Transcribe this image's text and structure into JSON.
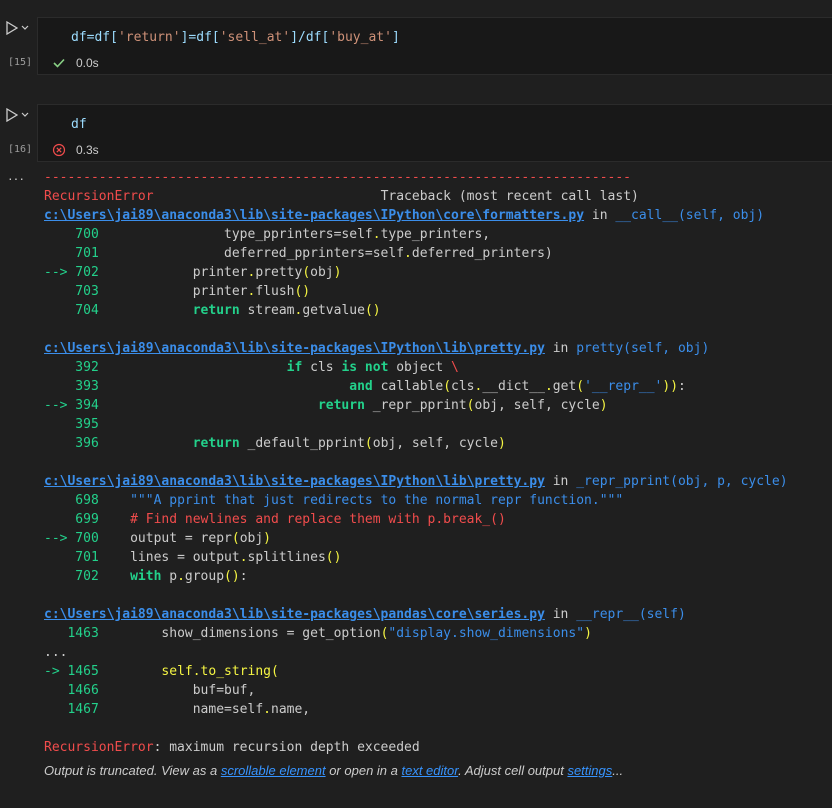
{
  "cells": [
    {
      "exec_count": "[15]",
      "code": [
        "df=df[",
        "'return'",
        "]=df[",
        "'sell_at'",
        "]/df[",
        "'buy_at'",
        "]"
      ],
      "status": "success",
      "time": "0.0s"
    },
    {
      "exec_count": "[16]",
      "code_text": "df",
      "status": "error",
      "time": "0.3s"
    }
  ],
  "output": {
    "more_icon": "ellipsis-icon",
    "dashes": "---------------------------------------------------------------------------",
    "error_name": "RecursionError",
    "traceback_header": "Traceback (most recent call last)",
    "frames": [
      {
        "path": "c:\\Users\\jai89\\anaconda3\\lib\\site-packages\\IPython\\core\\formatters.py",
        "in": " in ",
        "func": "__call__(self, obj)"
      },
      {
        "path": "c:\\Users\\jai89\\anaconda3\\lib\\site-packages\\IPython\\lib\\pretty.py",
        "in": " in ",
        "func": "pretty(self, obj)"
      },
      {
        "path": "c:\\Users\\jai89\\anaconda3\\lib\\site-packages\\IPython\\lib\\pretty.py",
        "in": " in ",
        "func": "_repr_pprint(obj, p, cycle)"
      },
      {
        "path": "c:\\Users\\jai89\\anaconda3\\lib\\site-packages\\pandas\\core\\series.py",
        "in": " in ",
        "func": "__repr__(self)"
      }
    ],
    "final_error_name": "RecursionError",
    "final_error_msg": ": maximum recursion depth exceeded",
    "footer": {
      "prefix": "Output is truncated. View as a ",
      "link1": "scrollable element",
      "mid1": " or open in a ",
      "link2": "text editor",
      "mid2": ". Adjust cell output ",
      "link3": "settings",
      "suffix": "..."
    }
  }
}
